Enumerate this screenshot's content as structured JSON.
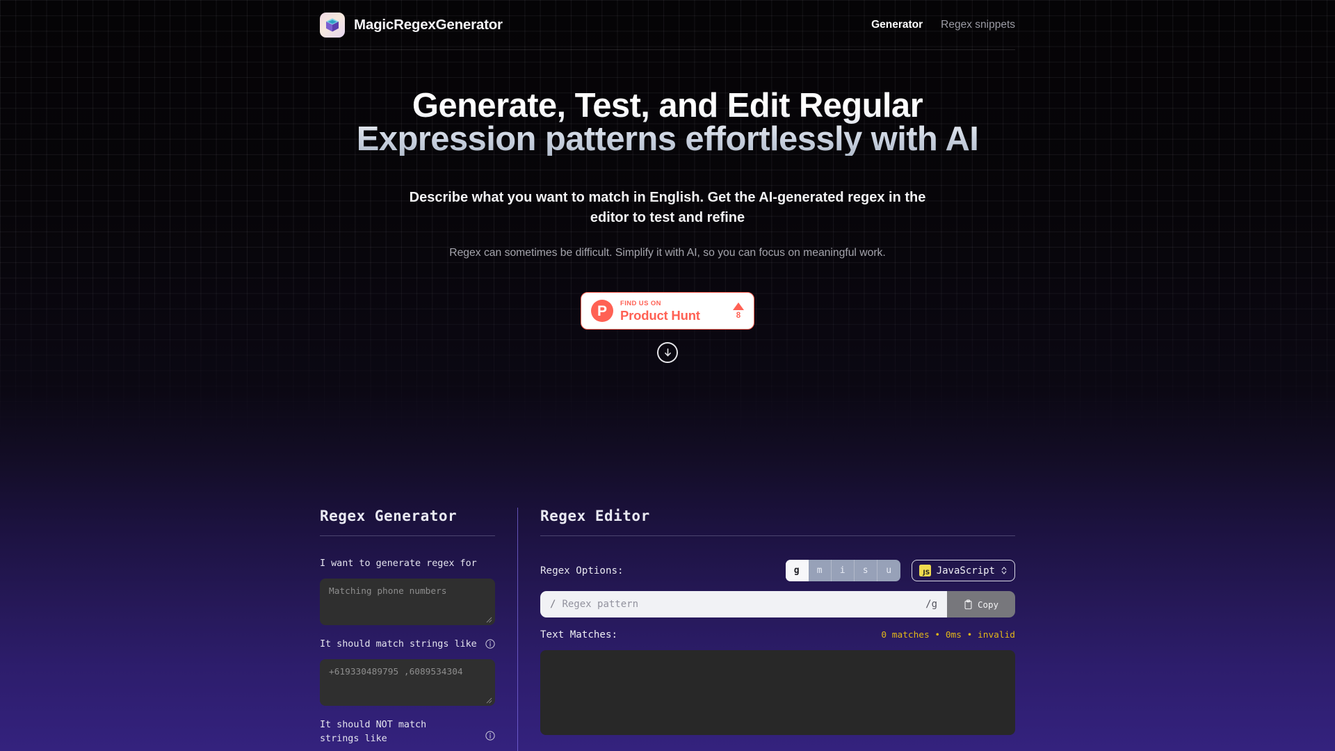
{
  "header": {
    "brand_name": "MagicRegexGenerator",
    "logo_icon": "gem-cube-icon",
    "nav": [
      {
        "label": "Generator",
        "active": true
      },
      {
        "label": "Regex snippets",
        "active": false
      }
    ]
  },
  "hero": {
    "headline": "Generate, Test, and Edit Regular Expression patterns effortlessly with AI",
    "subheadline": "Describe what you want to match in English. Get the AI-generated regex in the editor to test and refine",
    "description": "Regex can sometimes be difficult. Simplify it with AI, so you can focus on meaningful work.",
    "product_hunt": {
      "kicker": "FIND US ON",
      "title": "Product Hunt",
      "upvote_count": "8",
      "upvote_icon": "triangle-up-icon",
      "mark": "P",
      "accent_color": "#ff6154"
    },
    "scroll_down_icon": "arrow-down-circle-icon"
  },
  "generator": {
    "title": "Regex Generator",
    "fields": [
      {
        "label": "I want to generate regex for",
        "placeholder": "Matching phone numbers",
        "value": "",
        "has_info": false
      },
      {
        "label": "It should match strings like",
        "placeholder": "+619330489795 ,6089534304",
        "value": "",
        "has_info": true,
        "info_icon": "info-circle-icon"
      },
      {
        "label": "It should NOT match strings like",
        "placeholder": "",
        "value": "",
        "has_info": true,
        "info_icon": "info-circle-icon"
      }
    ]
  },
  "editor": {
    "title": "Regex Editor",
    "options_label": "Regex Options:",
    "flags": [
      {
        "label": "g",
        "active": true
      },
      {
        "label": "m",
        "active": false
      },
      {
        "label": "i",
        "active": false
      },
      {
        "label": "s",
        "active": false
      },
      {
        "label": "u",
        "active": false
      }
    ],
    "language": {
      "name": "JavaScript",
      "badge": "JS",
      "badge_color": "#f0db4f",
      "chevron_icon": "chevron-up-down-icon"
    },
    "pattern": {
      "prefix": "/",
      "placeholder": "Regex pattern",
      "value": "",
      "suffix": "/g",
      "copy_label": "Copy",
      "copy_icon": "clipboard-icon"
    },
    "matches_label": "Text Matches:",
    "matches_status": "0 matches • 0ms • invalid",
    "matches_status_color": "#e3b719",
    "match_output": ""
  }
}
